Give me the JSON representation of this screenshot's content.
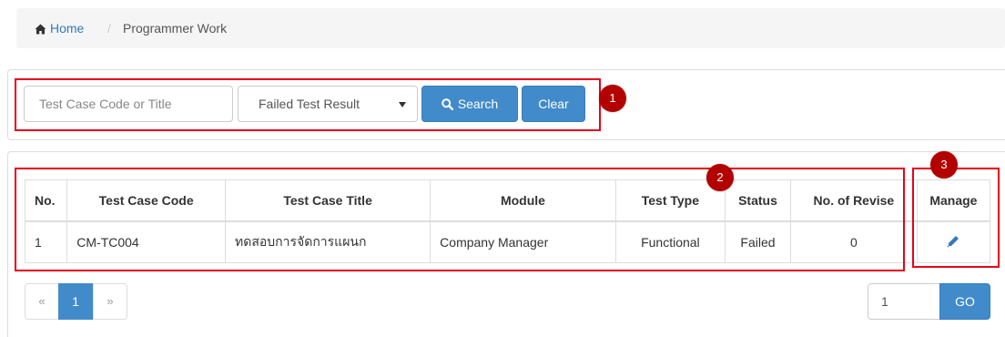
{
  "breadcrumb": {
    "home_label": "Home",
    "separator": "/",
    "current": "Programmer Work"
  },
  "search": {
    "placeholder": "Test Case Code or Title",
    "filter_selected": "Failed Test Result",
    "search_label": "Search",
    "clear_label": "Clear"
  },
  "table": {
    "headers": [
      "No.",
      "Test Case Code",
      "Test Case Title",
      "Module",
      "Test Type",
      "Status",
      "No. of Revise",
      "Manage"
    ],
    "rows": [
      {
        "no": "1",
        "code": "CM-TC004",
        "title": "ทดสอบการจัดการแผนก",
        "module": "Company Manager",
        "type": "Functional",
        "status": "Failed",
        "revise": "0",
        "manage_icon": "pencil-icon"
      }
    ]
  },
  "pagination": {
    "prev": "«",
    "current": "1",
    "next": "»",
    "page_input_value": "1",
    "go_label": "GO"
  },
  "annotations": [
    "1",
    "2",
    "3"
  ],
  "colors": {
    "primary": "#428bca",
    "link": "#337ab7",
    "marker": "#b30000",
    "highlight_box": "#e8001c"
  }
}
